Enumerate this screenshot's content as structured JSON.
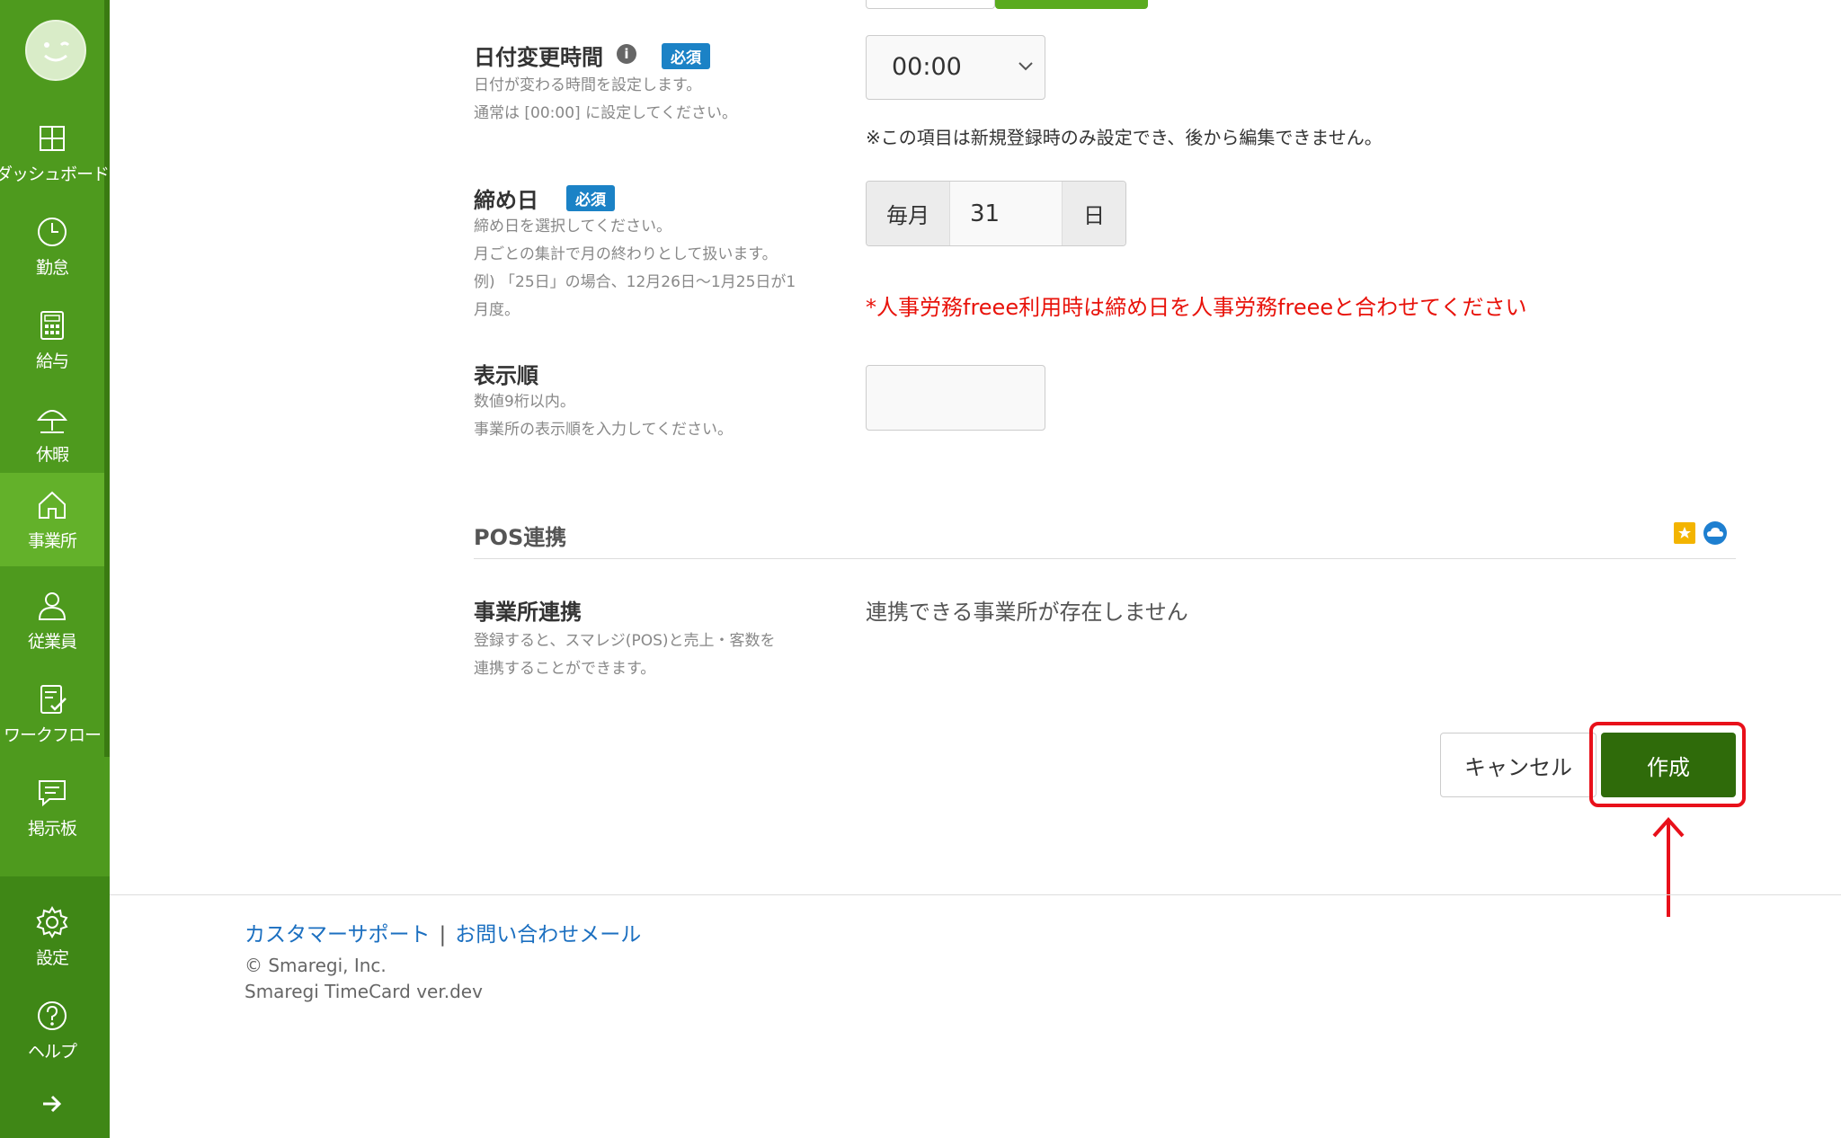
{
  "sidebar": {
    "items": [
      {
        "label": "ダッシュボード",
        "icon": "dashboard-icon"
      },
      {
        "label": "勤怠",
        "icon": "clock-icon"
      },
      {
        "label": "給与",
        "icon": "calculator-icon"
      },
      {
        "label": "休暇",
        "icon": "umbrella-icon"
      },
      {
        "label": "事業所",
        "icon": "home-icon",
        "active": true
      },
      {
        "label": "従業員",
        "icon": "person-icon"
      },
      {
        "label": "ワークフロー",
        "icon": "checklist-icon"
      },
      {
        "label": "掲示板",
        "icon": "message-icon"
      },
      {
        "label": "設定",
        "icon": "gear-icon"
      },
      {
        "label": "ヘルプ",
        "icon": "help-icon"
      }
    ],
    "colors": {
      "bg": "#4e9a1e",
      "active": "#63b12a"
    }
  },
  "form": {
    "date_change": {
      "label": "日付変更時間",
      "badge": "必須",
      "help_line1": "日付が変わる時間を設定します。",
      "help_line2": "通常は [00:00] に設定してください。",
      "value": "00:00",
      "note": "※この項目は新規登録時のみ設定でき、後から編集できません。"
    },
    "closing_day": {
      "label": "締め日",
      "badge": "必須",
      "help_line1": "締め日を選択してください。",
      "help_line2": "月ごとの集計で月の終わりとして扱います。",
      "help_line3": "例) 「25日」の場合、12月26日〜1月25日が1",
      "help_line4": "月度。",
      "prefix": "毎月",
      "value": "31",
      "suffix": "日",
      "warning": "*人事労務freee利用時は締め日を人事労務freeeと合わせてください"
    },
    "display_order": {
      "label": "表示順",
      "help_line1": "数値9桁以内。",
      "help_line2": "事業所の表示順を入力してください。",
      "value": ""
    }
  },
  "pos_section": {
    "title": "POS連携",
    "link_label": "事業所連携",
    "help_line1": "登録すると、スマレジ(POS)と売上・客数を",
    "help_line2": "連携することができます。",
    "value": "連携できる事業所が存在しません"
  },
  "actions": {
    "cancel_label": "キャンセル",
    "create_label": "作成",
    "accent": "#2f6b0a",
    "highlight": "#e8101a"
  },
  "footer": {
    "support_link": "カスタマーサポート",
    "separator": "|",
    "contact_link": "お問い合わせメール",
    "copyright": "© Smaregi, Inc.",
    "version": "Smaregi TimeCard ver.dev"
  }
}
